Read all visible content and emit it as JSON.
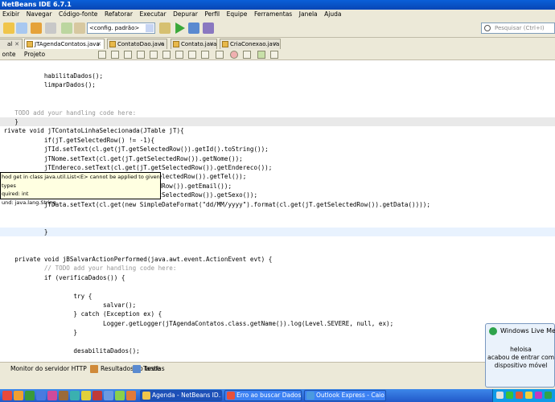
{
  "window": {
    "title": "NetBeans IDE 6.7.1"
  },
  "menu": [
    "Exibir",
    "Navegar",
    "Código-fonte",
    "Refatorar",
    "Executar",
    "Depurar",
    "Perfil",
    "Equipe",
    "Ferramentas",
    "Janela",
    "Ajuda"
  ],
  "toolbar": {
    "config": "<config. padrão>",
    "search_placeholder": "Pesquisar (Ctrl+I)"
  },
  "tabs": [
    {
      "label": "al",
      "close": "✕"
    },
    {
      "label": "JTAgendaContatos.java",
      "close": "✕",
      "active": true
    },
    {
      "label": "ContatoDao.java",
      "close": "✕"
    },
    {
      "label": "Contato.java",
      "close": "✕"
    },
    {
      "label": "CriaConexao.java",
      "close": "✕"
    }
  ],
  "subtabs": [
    "onte",
    "Projeto"
  ],
  "code_lines": [
    {
      "t": "            habilitaDados();",
      "s": ""
    },
    {
      "t": "            limparDados();",
      "s": ""
    },
    {
      "t": "",
      "s": ""
    },
    {
      "t": "",
      "s": ""
    },
    {
      "t": "    TODO add your handling code here:",
      "s": "cm"
    },
    {
      "t": "    }",
      "s": "",
      "hl": true
    },
    {
      "t": " rivate void jTContatoLinhaSelecionada(JTable jT){",
      "s": ""
    },
    {
      "t": "            if(jT.getSelectedRow() != -1){",
      "s": ""
    },
    {
      "t": "            jTId.setText(cl.get(jT.getSelectedRow()).getId().toString());",
      "s": ""
    },
    {
      "t": "            jTNome.setText(cl.get(jT.getSelectedRow()).getNome());",
      "s": ""
    },
    {
      "t": "            jTEndereco.setText(cl.get(jT.getSelectedRow()).getEndereco());",
      "s": ""
    },
    {
      "t": "                                          SelectedRow()).getTel());",
      "s": ""
    },
    {
      "t": "                                          edRow()).getEmail());",
      "s": ""
    },
    {
      "t": "                                     (jT.getSelectedRow()).getSexo());",
      "s": ""
    },
    {
      "t": "            jTData.setText(cl.get(new SimpleDateFormat(\"dd/MM/yyyy\").format(cl.get(jT.getSelectedRow()).getData())));",
      "s": ""
    },
    {
      "t": "",
      "s": ""
    },
    {
      "t": "",
      "s": ""
    },
    {
      "t": "            }",
      "s": "",
      "cur": true
    },
    {
      "t": "",
      "s": ""
    },
    {
      "t": "",
      "s": ""
    },
    {
      "t": "    private void jBSalvarActionPerformed(java.awt.event.ActionEvent evt) {",
      "s": ""
    },
    {
      "t": "            // TODO add your handling code here:",
      "s": "cm"
    },
    {
      "t": "            if (verificaDados()) {",
      "s": ""
    },
    {
      "t": "",
      "s": ""
    },
    {
      "t": "                    try {",
      "s": ""
    },
    {
      "t": "                            salvar();",
      "s": ""
    },
    {
      "t": "                    } catch (Exception ex) {",
      "s": ""
    },
    {
      "t": "                            Logger.getLogger(jTAgendaContatos.class.getName()).log(Level.SEVERE, null, ex);",
      "s": ""
    },
    {
      "t": "                    }",
      "s": ""
    },
    {
      "t": "",
      "s": ""
    },
    {
      "t": "                    desabilitaDados();",
      "s": ""
    }
  ],
  "tooltip": [
    "hod get in class java.util.List<E> cannot be applied to given types",
    "quired: int",
    "und: java.lang.String"
  ],
  "bottom_tabs": [
    "Monitor do servidor HTTP",
    "Resultados do teste",
    "Tarefas"
  ],
  "taskbar": {
    "buttons": [
      "Agenda - NetBeans ID...",
      "Erro ao buscar Dados - ...",
      "Outlook Express - Caio A..."
    ]
  },
  "notification": {
    "title": "Windows Live Messenger",
    "user": "heloisa",
    "line1": "acabou de entrar com",
    "line2": "dispositivo móvel"
  }
}
